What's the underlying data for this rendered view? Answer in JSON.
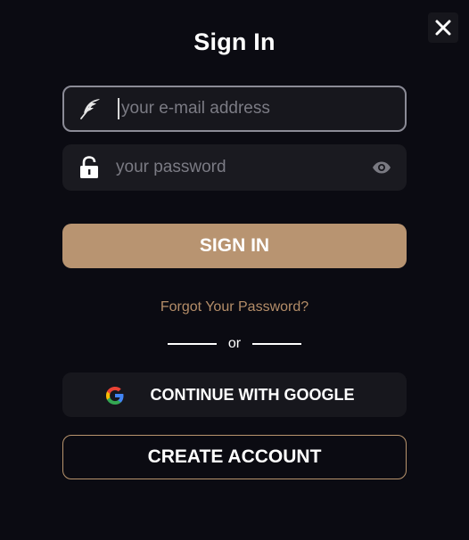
{
  "dialog": {
    "title": "Sign In",
    "close_icon": "close-icon"
  },
  "email": {
    "placeholder": "your e-mail address",
    "value": "",
    "icon": "feather-icon"
  },
  "password": {
    "placeholder": "your password",
    "value": "",
    "icon": "lock-icon",
    "toggle_icon": "eye-icon"
  },
  "actions": {
    "signin_label": "SIGN IN",
    "forgot_label": "Forgot Your Password?",
    "or_label": "or",
    "google_label": "CONTINUE WITH GOOGLE",
    "google_icon": "google-icon",
    "create_label": "CREATE ACCOUNT"
  },
  "colors": {
    "background": "#0b0b12",
    "accent": "#b89471",
    "link": "#b48d68",
    "field": "#1a1a20"
  }
}
